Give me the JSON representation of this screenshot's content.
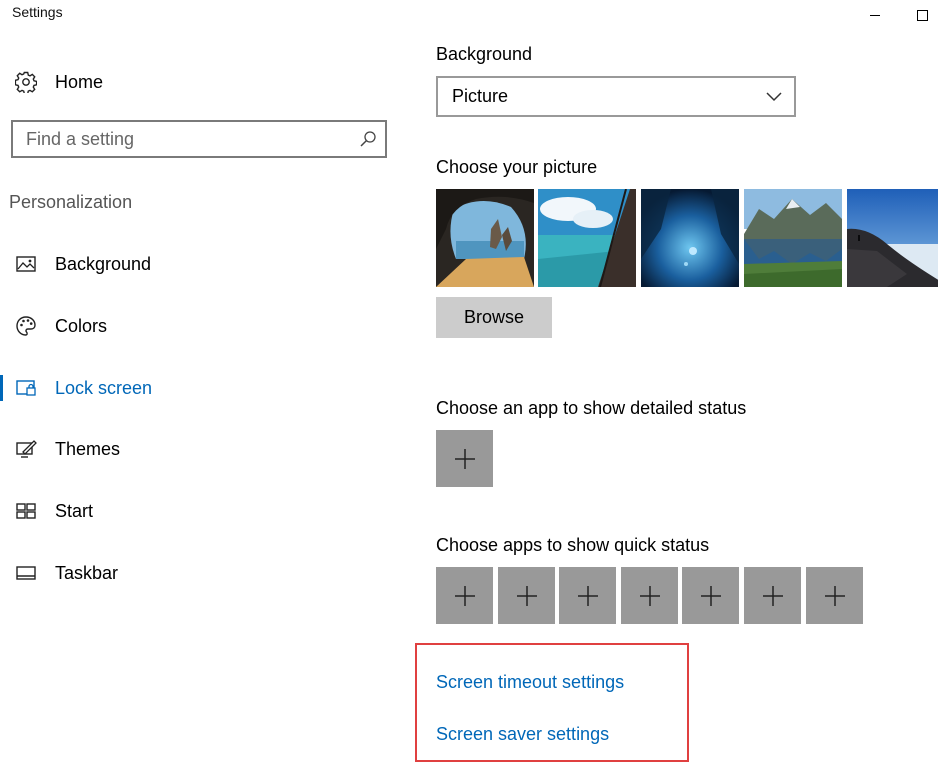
{
  "window": {
    "title": "Settings"
  },
  "sidebar": {
    "home_label": "Home",
    "search_placeholder": "Find a setting",
    "section_header": "Personalization",
    "items": [
      {
        "label": "Background",
        "icon": "picture-icon",
        "selected": false
      },
      {
        "label": "Colors",
        "icon": "palette-icon",
        "selected": false
      },
      {
        "label": "Lock screen",
        "icon": "lock-screen-icon",
        "selected": true
      },
      {
        "label": "Themes",
        "icon": "themes-icon",
        "selected": false
      },
      {
        "label": "Start",
        "icon": "start-tiles-icon",
        "selected": false
      },
      {
        "label": "Taskbar",
        "icon": "taskbar-icon",
        "selected": false
      }
    ]
  },
  "main": {
    "background_label": "Background",
    "background_value": "Picture",
    "choose_picture_label": "Choose your picture",
    "pictures": [
      "cave-beach",
      "turquoise-lagoon",
      "underwater-cave",
      "mountain-lake",
      "mountain-sea-of-clouds"
    ],
    "browse_label": "Browse",
    "detailed_status_label": "Choose an app to show detailed status",
    "quick_status_label": "Choose apps to show quick status",
    "quick_status_slots": 7,
    "screen_timeout_link": "Screen timeout settings",
    "screen_saver_link": "Screen saver settings"
  },
  "colors": {
    "accent": "#0067b8",
    "tile_gray": "#999999",
    "button_gray": "#cccccc",
    "highlight": "#e04040"
  }
}
